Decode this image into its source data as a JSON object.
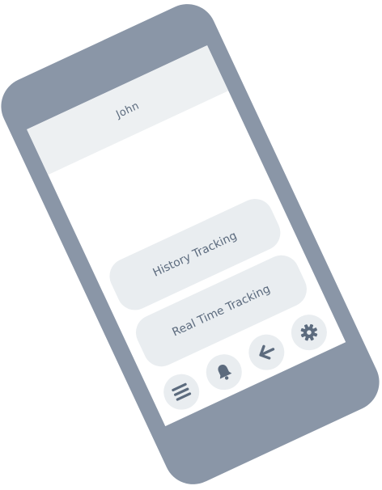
{
  "app": {
    "user_name": "John"
  },
  "menu": {
    "history_label": "History Tracking",
    "realtime_label": "Real Time Tracking"
  },
  "toolbar": {
    "icons": [
      "menu-icon",
      "bell-icon",
      "back-arrow-icon",
      "gear-icon"
    ]
  },
  "colors": {
    "device_frame": "#8a96a7",
    "header_bg": "#edf0f2",
    "button_bg": "#e9edf0",
    "text": "#5c6b7e",
    "icon": "#5c6b7e"
  }
}
